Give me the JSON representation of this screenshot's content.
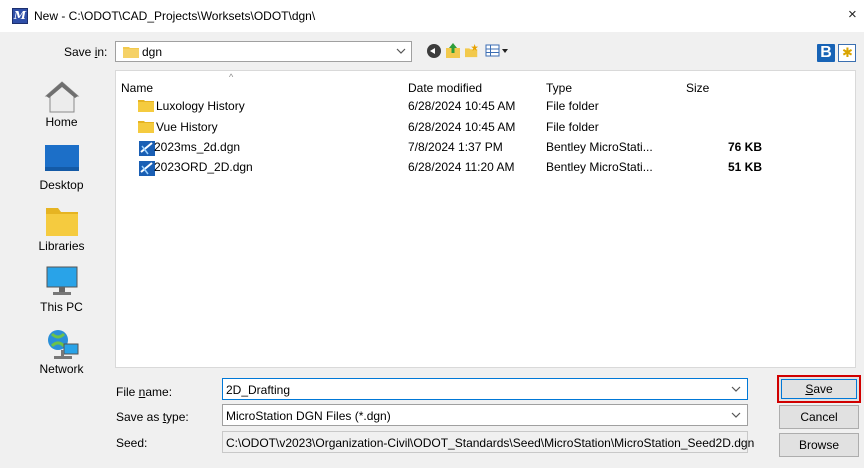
{
  "window": {
    "title": "New - C:\\ODOT\\CAD_Projects\\Worksets\\ODOT\\dgn\\",
    "close_glyph": "×"
  },
  "save_in": {
    "label_prefix": "Save ",
    "label_accel": "i",
    "label_suffix": "n:",
    "folder": "dgn"
  },
  "toolbar": {
    "logo_letter": "B"
  },
  "places": [
    {
      "label": "Home",
      "icon": "home-icon"
    },
    {
      "label": "Desktop",
      "icon": "desktop-icon"
    },
    {
      "label": "Libraries",
      "icon": "libraries-icon"
    },
    {
      "label": "This PC",
      "icon": "this-pc-icon"
    },
    {
      "label": "Network",
      "icon": "network-icon"
    }
  ],
  "file_list": {
    "columns": {
      "name": "Name",
      "date": "Date modified",
      "type": "Type",
      "size": "Size"
    },
    "sort_glyph": "^",
    "rows": [
      {
        "name": "Luxology History",
        "date": "6/28/2024 10:45 AM",
        "type": "File folder",
        "size": "",
        "icon": "folder-icon"
      },
      {
        "name": "Vue History",
        "date": "6/28/2024 10:45 AM",
        "type": "File folder",
        "size": "",
        "icon": "folder-icon"
      },
      {
        "name": "2023ms_2d.dgn",
        "date": "7/8/2024 1:37 PM",
        "type": "Bentley MicroStati...",
        "size": "76 KB",
        "icon": "dgn-file-icon"
      },
      {
        "name": "2023ORD_2D.dgn",
        "date": "6/28/2024 11:20 AM",
        "type": "Bentley MicroStati...",
        "size": "51 KB",
        "icon": "dgn-file-icon"
      }
    ]
  },
  "form": {
    "file_name": {
      "label_prefix": "File ",
      "label_accel": "n",
      "label_suffix": "ame:",
      "value": "2D_Drafting"
    },
    "save_as_type": {
      "label_prefix": "Save as ",
      "label_accel": "t",
      "label_suffix": "ype:",
      "value": "MicroStation DGN Files (*.dgn)"
    },
    "seed": {
      "label": "Seed:",
      "value": "C:\\ODOT\\v2023\\Organization-Civil\\ODOT_Standards\\Seed\\MicroStation\\MicroStation_Seed2D.dgn"
    }
  },
  "buttons": {
    "save_accel": "S",
    "save_rest": "ave",
    "cancel": "Cancel",
    "browse": "Browse"
  },
  "colors": {
    "accent": "#0078d7",
    "highlight": "#d10000",
    "folder": "#f2c94c"
  }
}
